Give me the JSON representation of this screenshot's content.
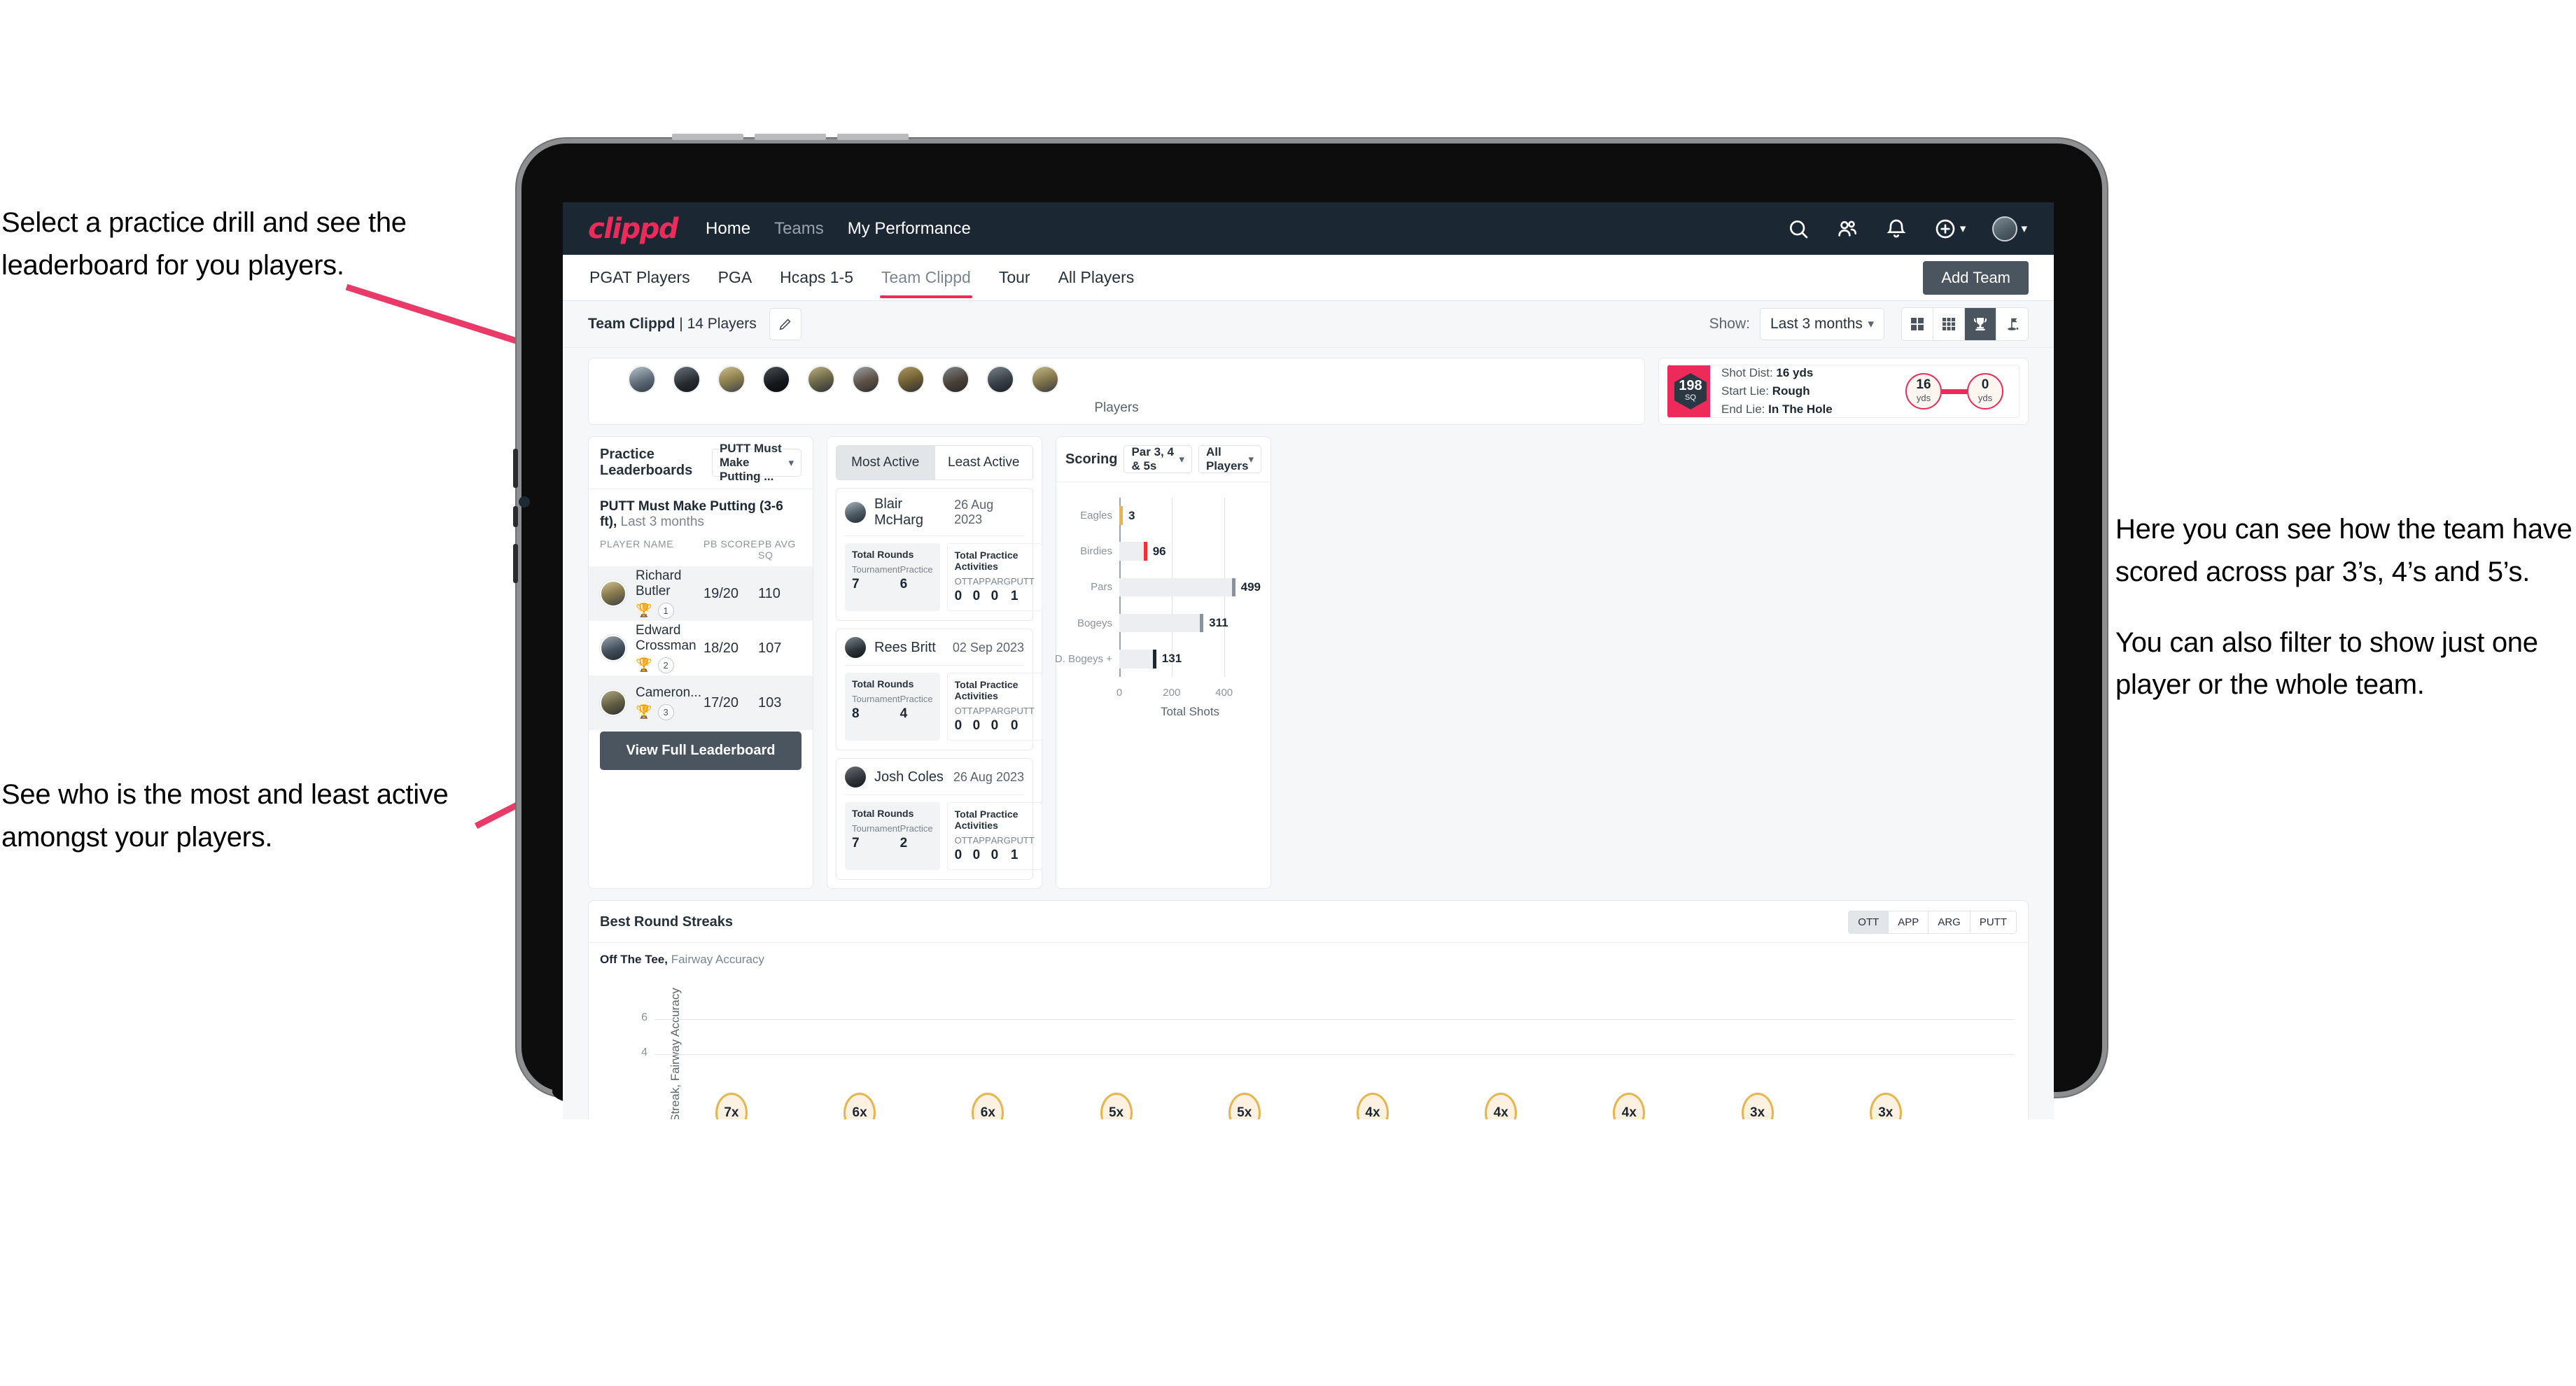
{
  "annotations": {
    "top_left": "Select a practice drill and see the leaderboard for you players.",
    "bottom_left": "See who is the most and least active amongst your players.",
    "right_1": "Here you can see how the team have scored across par 3’s, 4’s and 5’s.",
    "right_2": "You can also filter to show just one player or the whole team."
  },
  "topnav": {
    "logo": "clippd",
    "links": [
      {
        "label": "Home",
        "dim": false
      },
      {
        "label": "Teams",
        "dim": true
      },
      {
        "label": "My Performance",
        "dim": false
      }
    ],
    "icons": [
      "search-icon",
      "people-icon",
      "bell-icon",
      "plus-circle-icon",
      "avatar"
    ]
  },
  "tabs": [
    {
      "label": "PGAT Players",
      "active": false
    },
    {
      "label": "PGA",
      "active": false
    },
    {
      "label": "Hcaps 1-5",
      "active": false
    },
    {
      "label": "Team Clippd",
      "active": true
    },
    {
      "label": "Tour",
      "active": false
    },
    {
      "label": "All Players",
      "active": false
    }
  ],
  "add_team_label": "Add Team",
  "toolbar": {
    "team_name": "Team Clippd",
    "team_count": " | 14 Players",
    "edit_icon": "pencil-icon",
    "show_label": "Show:",
    "period_value": "Last 3 months",
    "view_modes": [
      {
        "name": "grid-2x2-icon",
        "active": false
      },
      {
        "name": "grid-3x3-icon",
        "active": false
      },
      {
        "name": "trophy-icon",
        "active": true
      },
      {
        "name": "golf-flag-icon",
        "active": false
      }
    ]
  },
  "players_strip": {
    "label": "Players",
    "avatar_count": 10
  },
  "shot_card": {
    "sq_value": "198",
    "sq_unit": "SQ",
    "lines": [
      {
        "k": "Shot Dist: ",
        "v": "16 yds"
      },
      {
        "k": "Start Lie: ",
        "v": "Rough"
      },
      {
        "k": "End Lie: ",
        "v": "In The Hole"
      }
    ],
    "start_dist": "16",
    "start_unit": "yds",
    "end_dist": "0",
    "end_unit": "yds"
  },
  "leaderboard": {
    "title": "Practice Leaderboards",
    "dropdown_value": "PUTT Must Make Putting ...",
    "drill_name": "PUTT Must Make Putting (3-6 ft),",
    "drill_period": " Last 3 months",
    "columns": [
      "PLAYER NAME",
      "PB SCORE",
      "PB AVG SQ"
    ],
    "rows": [
      {
        "name": "Richard Butler",
        "rank": "1",
        "trophy": "gold",
        "score": "19/20",
        "avg": "110"
      },
      {
        "name": "Edward Crossman",
        "rank": "2",
        "trophy": "silver",
        "score": "18/20",
        "avg": "107"
      },
      {
        "name": "Cameron...",
        "rank": "3",
        "trophy": "bronze",
        "score": "17/20",
        "avg": "103"
      }
    ],
    "view_full_label": "View Full Leaderboard"
  },
  "activity": {
    "tabs": [
      {
        "label": "Most Active",
        "active": true
      },
      {
        "label": "Least Active",
        "active": false
      }
    ],
    "rounds_title": "Total Rounds",
    "practice_title": "Total Practice Activities",
    "rounds_keys": [
      "Tournament",
      "Practice"
    ],
    "practice_keys": [
      "OTT",
      "APP",
      "ARG",
      "PUTT"
    ],
    "players": [
      {
        "name": "Blair McHarg",
        "date": "26 Aug 2023",
        "rounds": [
          "7",
          "6"
        ],
        "practice": [
          "0",
          "0",
          "0",
          "1"
        ]
      },
      {
        "name": "Rees Britt",
        "date": "02 Sep 2023",
        "rounds": [
          "8",
          "4"
        ],
        "practice": [
          "0",
          "0",
          "0",
          "0"
        ]
      },
      {
        "name": "Josh Coles",
        "date": "26 Aug 2023",
        "rounds": [
          "7",
          "2"
        ],
        "practice": [
          "0",
          "0",
          "0",
          "1"
        ]
      }
    ]
  },
  "scoring": {
    "title": "Scoring",
    "par_filter": "Par 3, 4 & 5s",
    "player_filter": "All Players"
  },
  "streaks": {
    "title": "Best Round Streaks",
    "segments": [
      {
        "label": "OTT",
        "active": true
      },
      {
        "label": "APP",
        "active": false
      },
      {
        "label": "ARG",
        "active": false
      },
      {
        "label": "PUTT",
        "active": false
      }
    ],
    "sub_bold": "Off The Tee,",
    "sub_rest": " Fairway Accuracy"
  },
  "chart_data": [
    {
      "type": "bar",
      "orientation": "horizontal",
      "title": "Scoring",
      "categories": [
        "Eagles",
        "Birdies",
        "Pars",
        "Bogeys",
        "D. Bogeys +"
      ],
      "values": [
        3,
        96,
        499,
        311,
        131
      ],
      "cap_colors": [
        "#e8b44c",
        "#ef3333",
        "#8a939b",
        "#8a939b",
        "#1b2733"
      ],
      "xlabel": "Total Shots",
      "ylabel": "",
      "xlim": [
        0,
        540
      ],
      "xticks": [
        0,
        200,
        400
      ],
      "grid": true,
      "legend": "none"
    },
    {
      "type": "lollipop",
      "title": "Best Round Streaks",
      "subtitle": "Off The Tee, Fairway Accuracy",
      "ylabel": "Streak, Fairway Accuracy",
      "ylim": [
        0,
        8
      ],
      "yticks": [
        4,
        6
      ],
      "values": [
        7,
        6,
        6,
        5,
        5,
        4,
        4,
        4,
        3,
        3
      ],
      "labels": [
        "7x",
        "6x",
        "6x",
        "5x",
        "5x",
        "4x",
        "4x",
        "4x",
        "3x",
        "3x"
      ],
      "grid": true
    }
  ]
}
